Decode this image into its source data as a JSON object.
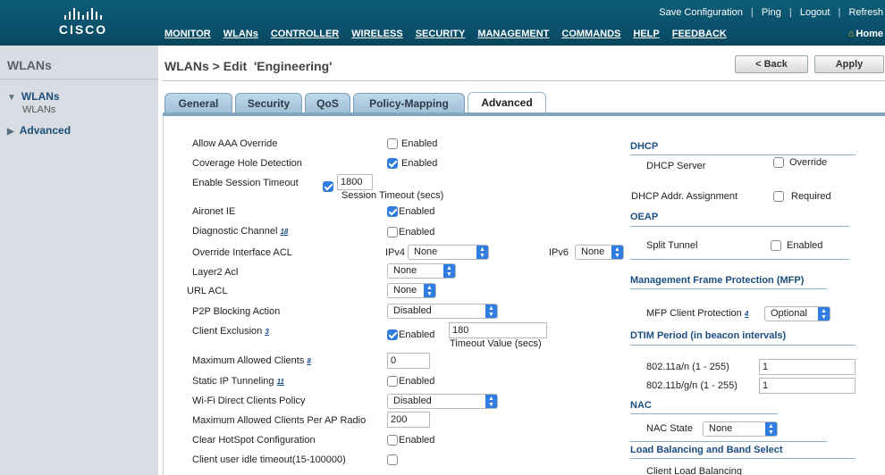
{
  "header": {
    "brand": "CISCO",
    "links": {
      "save": "Save Configuration",
      "ping": "Ping",
      "logout": "Logout",
      "refresh": "Refresh",
      "sep": "|"
    },
    "nav": [
      "MONITOR",
      "WLANs",
      "CONTROLLER",
      "WIRELESS",
      "SECURITY",
      "MANAGEMENT",
      "COMMANDS",
      "HELP",
      "FEEDBACK"
    ],
    "home": "Home"
  },
  "sidebar": {
    "title": "WLANs",
    "wlans": "WLANs",
    "wlans_sub": "WLANs",
    "advanced": "Advanced"
  },
  "page": {
    "title": "WLANs > Edit  'Engineering'",
    "back": "< Back",
    "apply": "Apply"
  },
  "tabs": [
    "General",
    "Security",
    "QoS",
    "Policy-Mapping",
    "Advanced"
  ],
  "left": {
    "allow_aaa": "Allow AAA Override",
    "enabled": "Enabled",
    "coverage": "Coverage Hole Detection",
    "session": "Enable Session Timeout",
    "session_value": "1800",
    "session_caption": "Session Timeout (secs)",
    "aironet": "Aironet IE",
    "diag": "Diagnostic Channel",
    "diag_ref": "18",
    "override_acl": "Override Interface ACL",
    "ipv4": "IPv4",
    "ipv4_value": "None",
    "ipv6": "IPv6",
    "ipv6_value": "None",
    "layer2": "Layer2 Acl",
    "layer2_value": "None",
    "url_acl": "URL ACL",
    "url_value": "None",
    "p2p": "P2P Blocking Action",
    "p2p_value": "Disabled",
    "client_excl": "Client Exclusion",
    "client_excl_ref": "3",
    "excl_value": "180",
    "excl_caption": "Timeout Value (secs)",
    "max_clients": "Maximum Allowed Clients",
    "max_clients_ref": "8",
    "max_clients_value": "0",
    "static_ip": "Static IP Tunneling",
    "static_ip_ref": "11",
    "wifi_direct": "Wi-Fi Direct Clients Policy",
    "wifi_direct_value": "Disabled",
    "max_ap": "Maximum Allowed Clients Per AP Radio",
    "max_ap_value": "200",
    "hotspot": "Clear HotSpot Configuration",
    "idle": "Client user idle timeout(15-100000)"
  },
  "right": {
    "dhcp": "DHCP",
    "dhcp_server": "DHCP Server",
    "override": "Override",
    "dhcp_assign": "DHCP Addr. Assignment",
    "required": "Required",
    "oeap": "OEAP",
    "split": "Split Tunnel",
    "enabled": "Enabled",
    "mfp": "Management Frame Protection (MFP)",
    "mfp_client": "MFP Client Protection",
    "mfp_ref": "4",
    "mfp_value": "Optional",
    "dtim": "DTIM Period (in beacon intervals)",
    "dtim_a": "802.11a/n (1 - 255)",
    "dtim_a_value": "1",
    "dtim_b": "802.11b/g/n (1 - 255)",
    "dtim_b_value": "1",
    "nac": "NAC",
    "nac_state": "NAC State",
    "nac_value": "None",
    "lb": "Load Balancing and Band Select",
    "client_lb": "Client Load Balancing"
  }
}
